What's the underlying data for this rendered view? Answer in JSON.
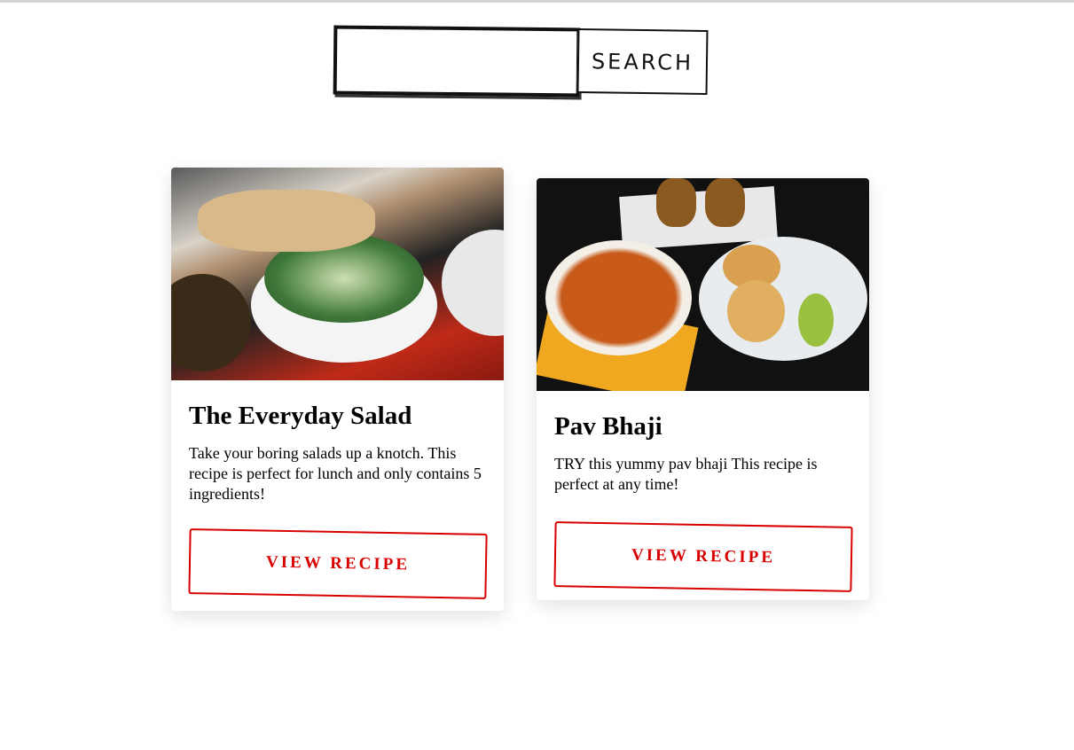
{
  "search": {
    "placeholder": "",
    "value": "",
    "button_label": "SEARCH"
  },
  "recipes": [
    {
      "title": "The Everyday Salad",
      "description": "Take your boring salads up a knotch. This recipe is perfect for lunch and only contains 5 ingredients!",
      "button_label": "VIEW RECIPE",
      "image": "salad-photo"
    },
    {
      "title": "Pav Bhaji",
      "description": "TRY this yummy pav bhaji This recipe is perfect at any time!",
      "button_label": "VIEW RECIPE",
      "image": "pav-bhaji-photo"
    }
  ],
  "colors": {
    "accent": "#d90000"
  }
}
